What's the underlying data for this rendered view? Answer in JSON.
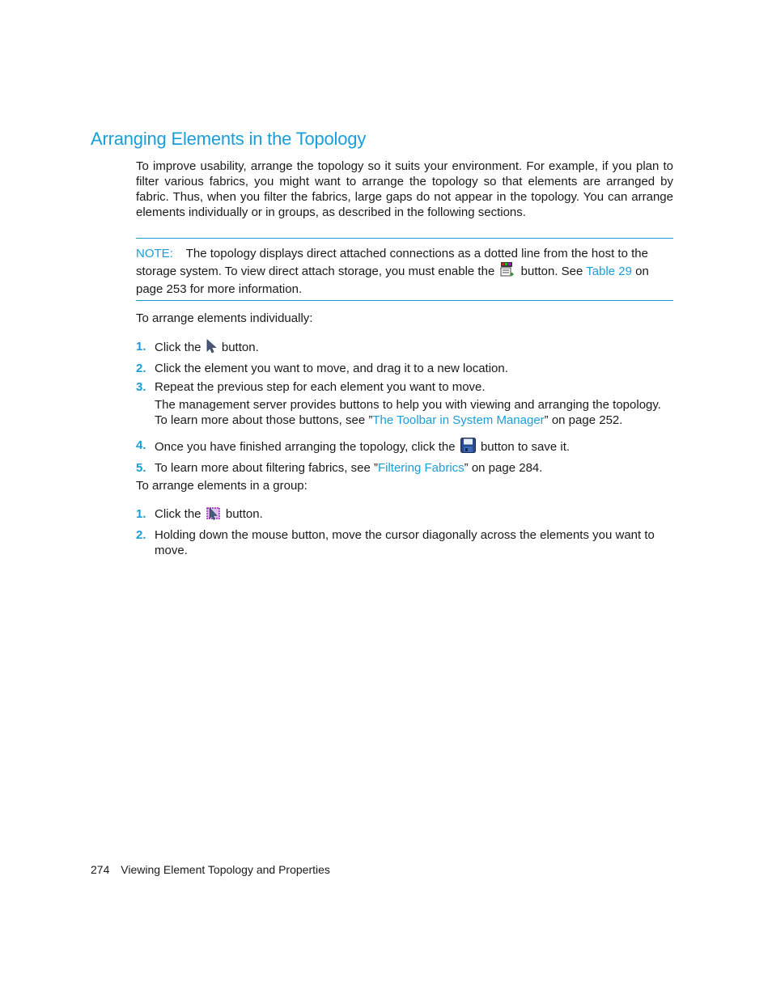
{
  "section": {
    "title": "Arranging Elements in the Topology",
    "intro": "To improve usability, arrange the topology so it suits your environment. For example, if you plan to filter various fabrics, you might want to arrange the topology so that elements are arranged by fabric. Thus, when you filter the fabrics, large gaps do not appear in the topology. You can arrange elements individually or in groups, as described in the following sections."
  },
  "note": {
    "label": "NOTE:",
    "text_before_icon": "The topology displays direct attached connections as a dotted line from the host to the storage system. To view direct attach storage, you must enable the",
    "icon": "direct-attach-storage-icon",
    "text_after_icon": "button. See",
    "link": "Table 29",
    "text_end": "on page 253 for more information."
  },
  "individual": {
    "lead": "To arrange elements individually:",
    "steps": [
      {
        "num": "1.",
        "before": "Click the",
        "icon": "pointer-arrow-icon",
        "after": "button."
      },
      {
        "num": "2.",
        "text": "Click the element you want to move, and drag it to a new location."
      },
      {
        "num": "3.",
        "text": "Repeat the previous step for each element you want to move.",
        "sub_before": "The management server provides buttons to help you with viewing and arranging the topology. To learn more about those buttons, see ”",
        "sub_link": "The Toolbar in System Manager",
        "sub_after": "” on page 252."
      },
      {
        "num": "4.",
        "before": "Once you have finished arranging the topology, click the",
        "icon": "save-floppy-icon",
        "after": "button to save it."
      },
      {
        "num": "5.",
        "before": "To learn more about filtering fabrics, see ”",
        "link": "Filtering Fabrics",
        "after": "” on page 284."
      }
    ]
  },
  "group": {
    "lead": "To arrange elements in a group:",
    "steps": [
      {
        "num": "1.",
        "before": "Click the",
        "icon": "group-select-icon",
        "after": "button."
      },
      {
        "num": "2.",
        "text": "Holding down the mouse button, move the cursor diagonally across the elements you want to move."
      }
    ]
  },
  "footer": {
    "page_number": "274",
    "chapter": "Viewing Element Topology and Properties"
  },
  "colors": {
    "accent": "#1a9ed8",
    "text": "#1a1a1a"
  }
}
